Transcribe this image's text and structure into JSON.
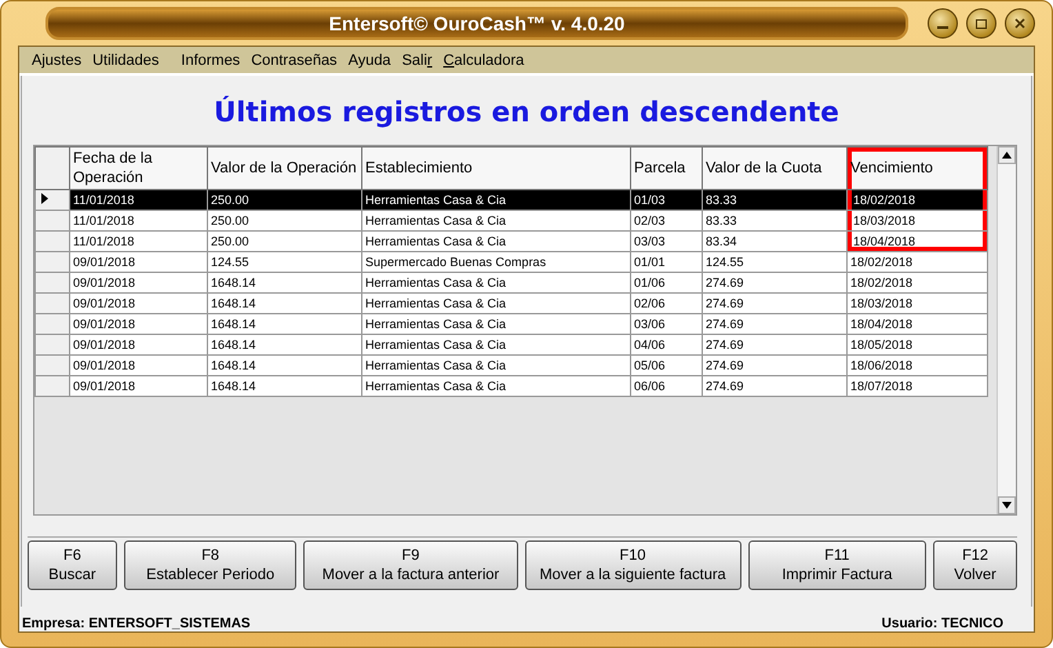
{
  "window": {
    "title": "Entersoft© OuroCash™ v. 4.0.20"
  },
  "menu": [
    {
      "before": "Ajustes"
    },
    {
      "before": "Utilidades"
    },
    {
      "before": "Informes"
    },
    {
      "before": "Contraseñas"
    },
    {
      "before": "Ayuda"
    },
    {
      "before": "Sali",
      "key": "r"
    },
    {
      "key": "C",
      "after": "alculadora"
    }
  ],
  "heading": "Últimos registros en orden descendente",
  "table": {
    "columns": [
      {
        "label": "Fecha de la Operación",
        "highlighted": false
      },
      {
        "label": "Valor de la Operación",
        "highlighted": false
      },
      {
        "label": "Establecimiento",
        "highlighted": false
      },
      {
        "label": "Parcela",
        "highlighted": false
      },
      {
        "label": "Valor de la Cuota",
        "highlighted": false
      },
      {
        "label": "Vencimiento",
        "highlighted": true
      }
    ],
    "rows": [
      {
        "selected": true,
        "highlighted": true,
        "cells": [
          "11/01/2018",
          "250.00",
          "Herramientas Casa & Cia",
          "01/03",
          "83.33",
          "18/02/2018"
        ]
      },
      {
        "selected": false,
        "highlighted": true,
        "cells": [
          "11/01/2018",
          "250.00",
          "Herramientas Casa & Cia",
          "02/03",
          "83.33",
          "18/03/2018"
        ]
      },
      {
        "selected": false,
        "highlighted": true,
        "cells": [
          "11/01/2018",
          "250.00",
          "Herramientas Casa & Cia",
          "03/03",
          "83.34",
          "18/04/2018"
        ]
      },
      {
        "selected": false,
        "highlighted": false,
        "cells": [
          "09/01/2018",
          "124.55",
          "Supermercado Buenas Compras",
          "01/01",
          "124.55",
          "18/02/2018"
        ]
      },
      {
        "selected": false,
        "highlighted": false,
        "cells": [
          "09/01/2018",
          "1648.14",
          "Herramientas Casa & Cia",
          "01/06",
          "274.69",
          "18/02/2018"
        ]
      },
      {
        "selected": false,
        "highlighted": false,
        "cells": [
          "09/01/2018",
          "1648.14",
          "Herramientas Casa & Cia",
          "02/06",
          "274.69",
          "18/03/2018"
        ]
      },
      {
        "selected": false,
        "highlighted": false,
        "cells": [
          "09/01/2018",
          "1648.14",
          "Herramientas Casa & Cia",
          "03/06",
          "274.69",
          "18/04/2018"
        ]
      },
      {
        "selected": false,
        "highlighted": false,
        "cells": [
          "09/01/2018",
          "1648.14",
          "Herramientas Casa & Cia",
          "04/06",
          "274.69",
          "18/05/2018"
        ]
      },
      {
        "selected": false,
        "highlighted": false,
        "cells": [
          "09/01/2018",
          "1648.14",
          "Herramientas Casa & Cia",
          "05/06",
          "274.69",
          "18/06/2018"
        ]
      },
      {
        "selected": false,
        "highlighted": false,
        "cells": [
          "09/01/2018",
          "1648.14",
          "Herramientas Casa & Cia",
          "06/06",
          "274.69",
          "18/07/2018"
        ]
      }
    ]
  },
  "buttons": [
    {
      "key": "F6",
      "label": "Buscar"
    },
    {
      "key": "F8",
      "label": "Establecer Periodo"
    },
    {
      "key": "F9",
      "label": "Mover a la factura anterior"
    },
    {
      "key": "F10",
      "label": "Mover a la siguiente factura"
    },
    {
      "key": "F11",
      "label": "Imprimir Factura"
    },
    {
      "key": "F12",
      "label": "Volver"
    }
  ],
  "status_bar": {
    "company": "Empresa: ENTERSOFT_SISTEMAS",
    "user": "Usuario: TECNICO"
  }
}
